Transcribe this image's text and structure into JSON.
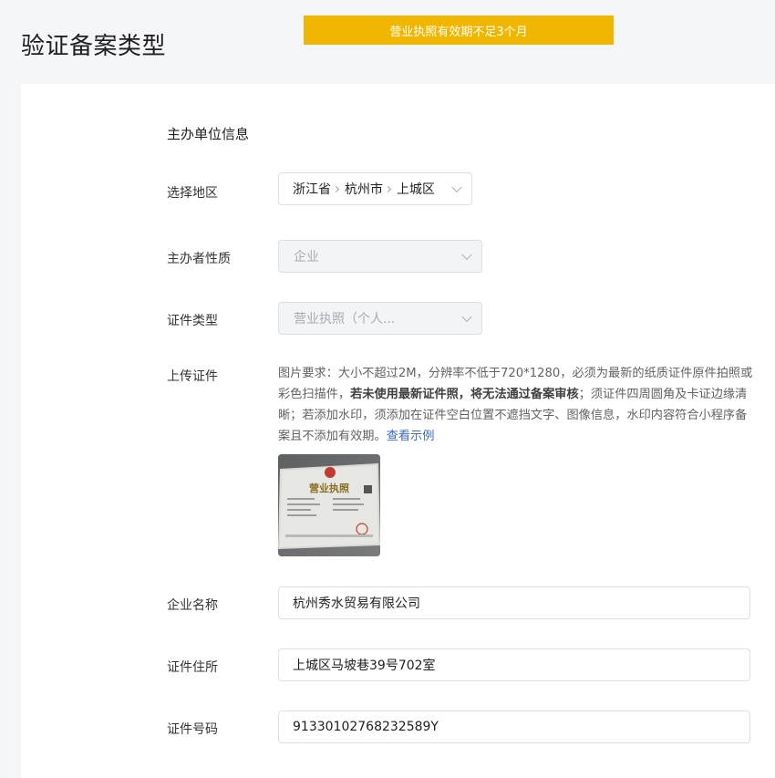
{
  "page": {
    "title": "验证备案类型"
  },
  "banner": {
    "text": "营业执照有效期不足3个月",
    "color": "#f1b600"
  },
  "form": {
    "section_title": "主办单位信息",
    "region": {
      "label": "选择地区",
      "province": "浙江省",
      "city": "杭州市",
      "district": "上城区"
    },
    "nature": {
      "label": "主办者性质",
      "value": "企业"
    },
    "cert_type": {
      "label": "证件类型",
      "value": "营业执照（个人..."
    },
    "upload": {
      "label": "上传证件",
      "desc_part1": "图片要求：大小不超过2M，分辨率不低于720*1280，必须为最新的纸质证件原件拍照或彩色扫描件，",
      "desc_bold": "若未使用最新证件照，将无法通过备案审核",
      "desc_part2": "；须证件四周圆角及卡证边缘清晰；若添加水印，须添加在证件空白位置不遮挡文字、图像信息，水印内容符合小程序备案且不添加有效期。",
      "example_link": "查看示例",
      "thumb_title": "营业执照",
      "link_color": "#3b6bc6"
    },
    "company_name": {
      "label": "企业名称",
      "value": "杭州秀水贸易有限公司"
    },
    "cert_address": {
      "label": "证件住所",
      "value": "上城区马坡巷39号702室"
    },
    "cert_number": {
      "label": "证件号码",
      "value": "91330102768232589Y"
    }
  }
}
